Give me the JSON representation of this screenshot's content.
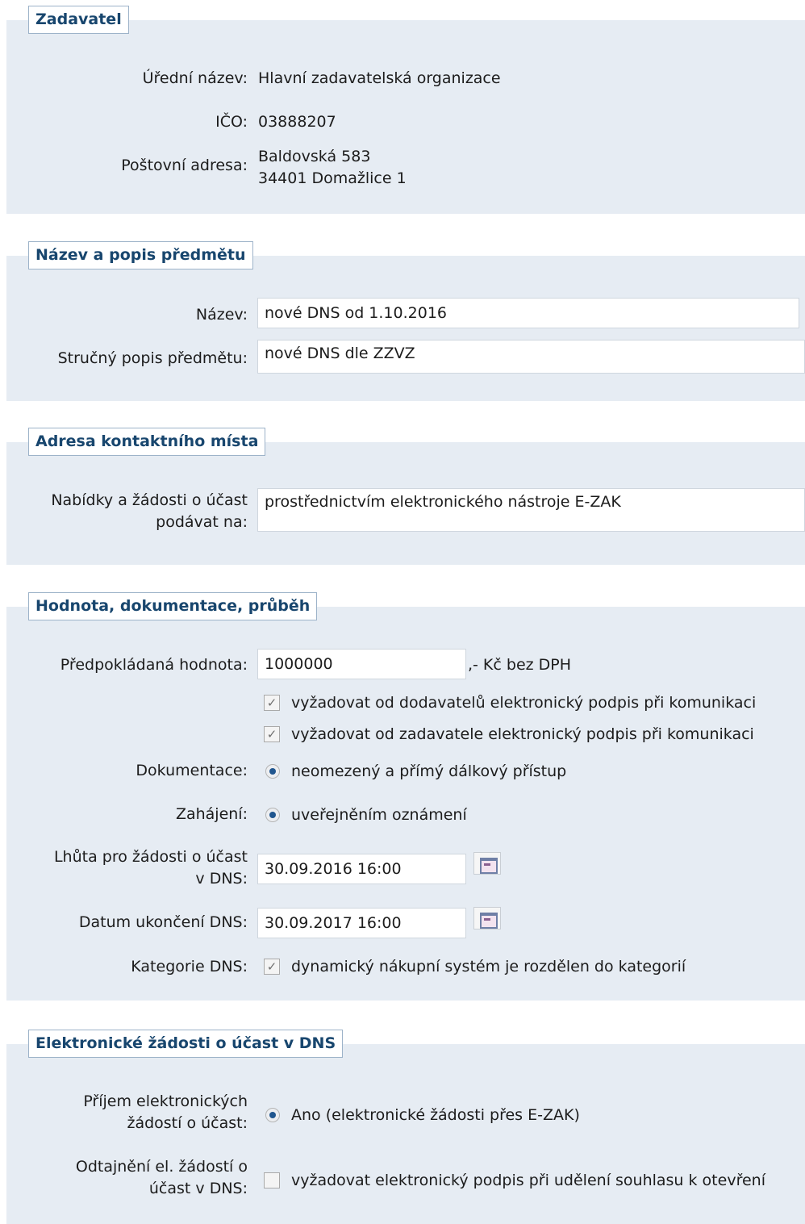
{
  "zadavatel": {
    "title": "Zadavatel",
    "official_name_label": "Úřední název:",
    "official_name_value": "Hlavní zadavatelská organizace",
    "ico_label": "IČO:",
    "ico_value": "03888207",
    "address_label": "Poštovní adresa:",
    "address_line1": "Baldovská 583",
    "address_line2": "34401 Domažlice 1"
  },
  "subject": {
    "title": "Název a popis předmětu",
    "name_label": "Název:",
    "name_value": "nové DNS od 1.10.2016",
    "desc_label": "Stručný popis předmětu:",
    "desc_value": "nové DNS dle ZZVZ"
  },
  "contact": {
    "title": "Adresa kontaktního místa",
    "submit_label_line1": "Nabídky a žádosti o účast",
    "submit_label_line2": "podávat na:",
    "submit_value": "prostřednictvím elektronického nástroje E-ZAK"
  },
  "value_doc": {
    "title": "Hodnota, dokumentace, průběh",
    "est_value_label": "Předpokládaná hodnota:",
    "est_value": "1000000",
    "est_value_suffix": ",- Kč bez DPH",
    "cb_suppliers_label": "vyžadovat od dodavatelů elektronický podpis při komunikaci",
    "cb_suppliers_checked": true,
    "cb_contracting_label": "vyžadovat od zadavatele elektronický podpis při komunikaci",
    "cb_contracting_checked": true,
    "documentation_label": "Dokumentace:",
    "documentation_option": "neomezený a přímý dálkový přístup",
    "start_label": "Zahájení:",
    "start_option": "uveřejněním oznámení",
    "deadline_label_line1": "Lhůta pro žádosti o účast",
    "deadline_label_line2": "v DNS:",
    "deadline_value": "30.09.2016 16:00",
    "end_label": "Datum ukončení DNS:",
    "end_value": "30.09.2017 16:00",
    "category_label": "Kategorie DNS:",
    "category_option": "dynamický nákupní systém je rozdělen do kategorií",
    "category_checked": true
  },
  "electronic": {
    "title": "Elektronické žádosti o účast v DNS",
    "receipt_label_line1": "Příjem elektronických",
    "receipt_label_line2": "žádostí o účast:",
    "receipt_option": "Ano (elektronické žádosti přes E-ZAK)",
    "decrypt_label_line1": "Odtajnění el. žádostí o",
    "decrypt_label_line2": "účast v DNS:",
    "decrypt_option": "vyžadovat elektronický podpis při udělení souhlasu k otevření",
    "decrypt_checked": false
  },
  "icons": {
    "checkbox_mark": "✓",
    "calendar": "calendar-icon",
    "radio": "radio-selected-icon"
  },
  "colors": {
    "panel_bg": "#e6ecf3",
    "legend_text": "#18466e",
    "legend_border": "#9db3c9"
  }
}
